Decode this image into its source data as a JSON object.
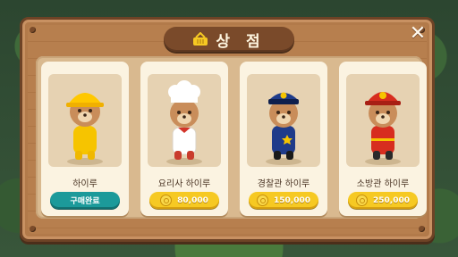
{
  "header": {
    "title": "상 점",
    "close_label": "✕"
  },
  "items": [
    {
      "name": "하이루",
      "status": "구매완료",
      "outfit": "raincoat",
      "accent": "#f6c400"
    },
    {
      "name": "요리사 하이루",
      "price": "80,000",
      "outfit": "chef",
      "accent": "#ffffff"
    },
    {
      "name": "경찰관 하이루",
      "price": "150,000",
      "outfit": "police",
      "accent": "#1f3b8a"
    },
    {
      "name": "소방관 하이루",
      "price": "250,000",
      "outfit": "firefighter",
      "accent": "#d72d1f"
    }
  ],
  "icons": {
    "shop": "basket-icon",
    "close": "close-icon",
    "currency": "coin-icon"
  },
  "colors": {
    "purchased": "#1c9a9a",
    "price": "#f6c923",
    "wood": "#b27a4a"
  }
}
